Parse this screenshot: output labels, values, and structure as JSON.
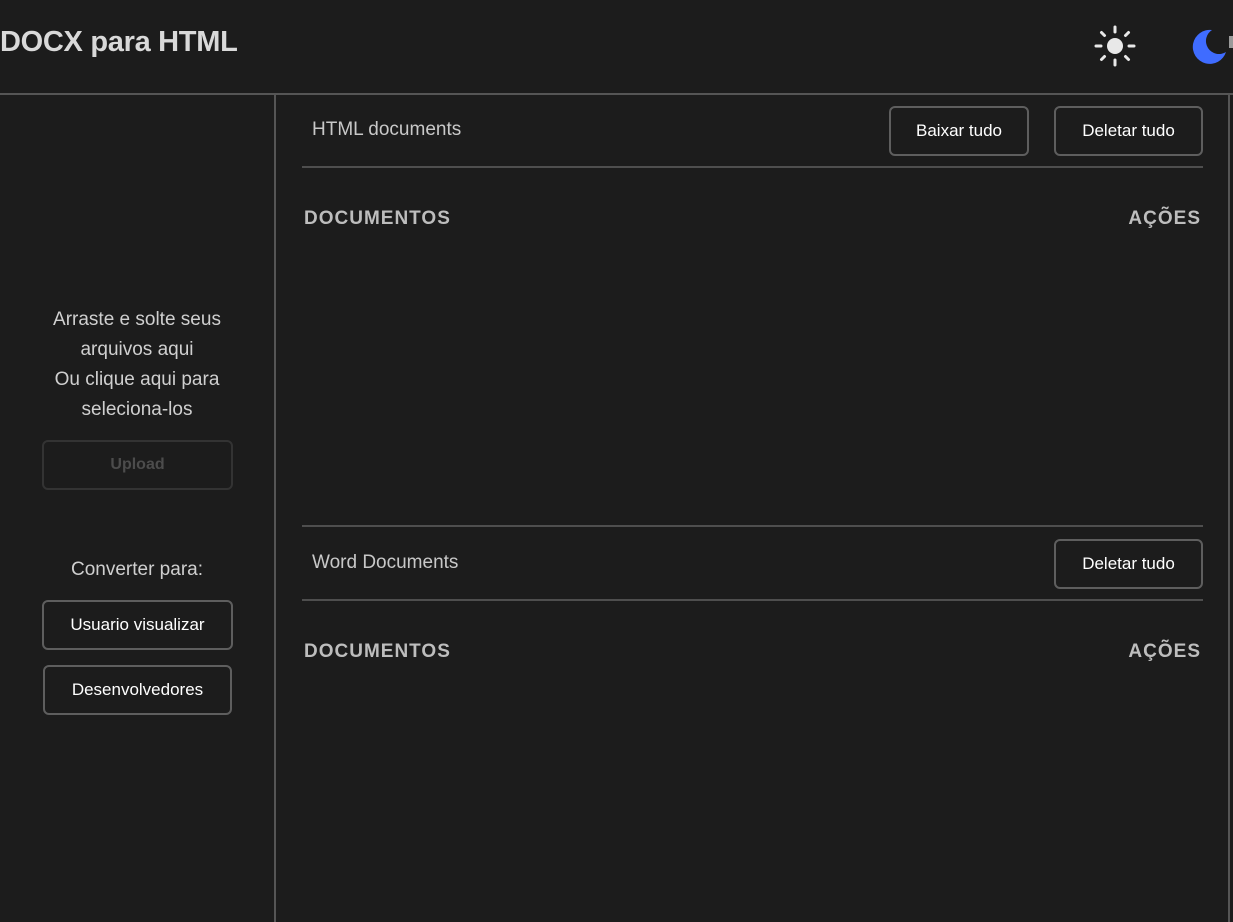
{
  "header": {
    "title": "DOCX para HTML",
    "light_theme_icon": "sun-icon",
    "dark_theme_icon": "moon-icon",
    "accent_color": "#3f6cff"
  },
  "sidebar": {
    "drop_line1": "Arraste e solte seus",
    "drop_line2": "arquivos aqui",
    "drop_line3": "Ou clique aqui para",
    "drop_line4": "seleciona-los",
    "upload_label": "Upload",
    "convert_label": "Converter para:",
    "user_view_label": "Usuario visualizar",
    "developers_label": "Desenvolvedores"
  },
  "html_section": {
    "title": "HTML documents",
    "download_all_label": "Baixar tudo",
    "delete_all_label": "Deletar tudo",
    "col_documents": "DOCUMENTOS",
    "col_actions": "AÇÕES"
  },
  "word_section": {
    "title": "Word Documents",
    "delete_all_label": "Deletar tudo",
    "col_documents": "DOCUMENTOS",
    "col_actions": "AÇÕES"
  }
}
